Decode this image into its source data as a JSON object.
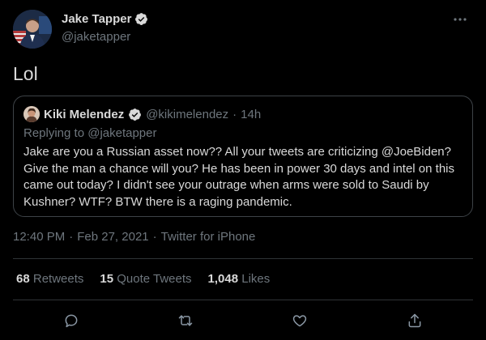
{
  "author": {
    "name": "Jake Tapper",
    "handle": "@jaketapper"
  },
  "tweet": {
    "text": "Lol"
  },
  "quoted": {
    "name": "Kiki Melendez",
    "handle": "@kikimelendez",
    "separator": "·",
    "time": "14h",
    "replying_to": "Replying to @jaketapper",
    "text": "Jake are you a Russian asset now?? All your tweets are criticizing @JoeBiden? Give the man a chance will you? He has been in power 30 days and intel on this came out today? I didn't see your outrage when arms were sold to Saudi by Kushner? WTF? BTW there is a raging pandemic."
  },
  "meta": {
    "time": "12:40 PM",
    "separator": "·",
    "date": "Feb 27, 2021",
    "source": "Twitter for iPhone"
  },
  "stats": {
    "retweets_count": "68",
    "retweets_label": "Retweets",
    "quotes_count": "15",
    "quotes_label": "Quote Tweets",
    "likes_count": "1,048",
    "likes_label": "Likes"
  },
  "colors": {
    "background": "#000000",
    "text": "#d9d9d9",
    "secondary": "#6e767d",
    "border": "#3d4247",
    "verified": "#d9d9d9"
  },
  "icons": [
    "verified-badge-icon",
    "more-icon",
    "reply-icon",
    "retweet-icon",
    "like-icon",
    "share-icon"
  ]
}
